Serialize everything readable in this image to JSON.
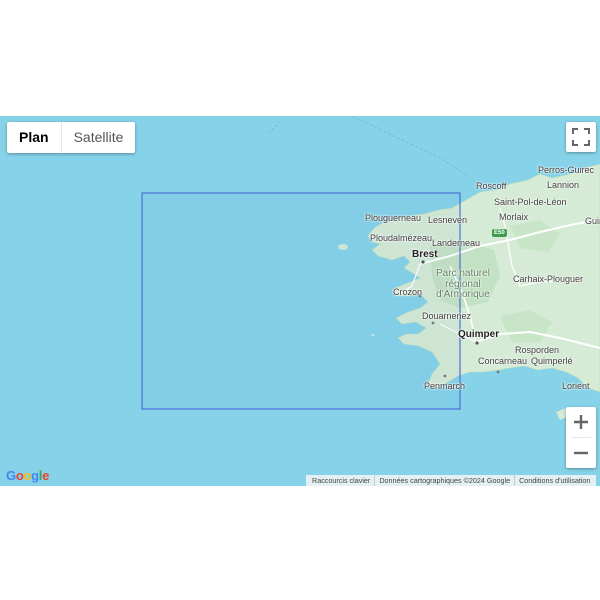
{
  "map_type": {
    "plan_label": "Plan",
    "satellite_label": "Satellite",
    "selected": "Plan"
  },
  "places": {
    "perros_guirec": "Perros-Guirec",
    "roscoff": "Roscoff",
    "lannion": "Lannion",
    "saint_pol": "Saint-Pol-de-Léon",
    "plouguerneau": "Plouguerneau",
    "lesneven": "Lesneven",
    "morlaix": "Morlaix",
    "guin": "Guin",
    "ploudalmezeau": "Ploudalmézeau",
    "landerneau": "Landerneau",
    "brest": "Brest",
    "park_line1": "Parc naturel",
    "park_line2": "régional",
    "park_line3": "d'Armorique",
    "carhaix": "Carhaix-Plouguer",
    "crozon": "Crozon",
    "douarnenez": "Douarnenez",
    "quimper": "Quimper",
    "rosporden": "Rosporden",
    "concarneau": "Concarneau",
    "quimperle": "Quimperlé",
    "lorient": "Lorient",
    "penmarch": "Penmarch"
  },
  "road_shield": "E50",
  "attribution": {
    "shortcuts": "Raccourcis clavier",
    "data": "Données cartographiques ©2024 Google",
    "terms": "Conditions d'utilisation"
  },
  "logo_letters": [
    "G",
    "o",
    "o",
    "g",
    "l",
    "e"
  ],
  "colors": {
    "water": "#86d3e9",
    "land": "#d5ebd5",
    "selection": "#4a6fd8"
  }
}
